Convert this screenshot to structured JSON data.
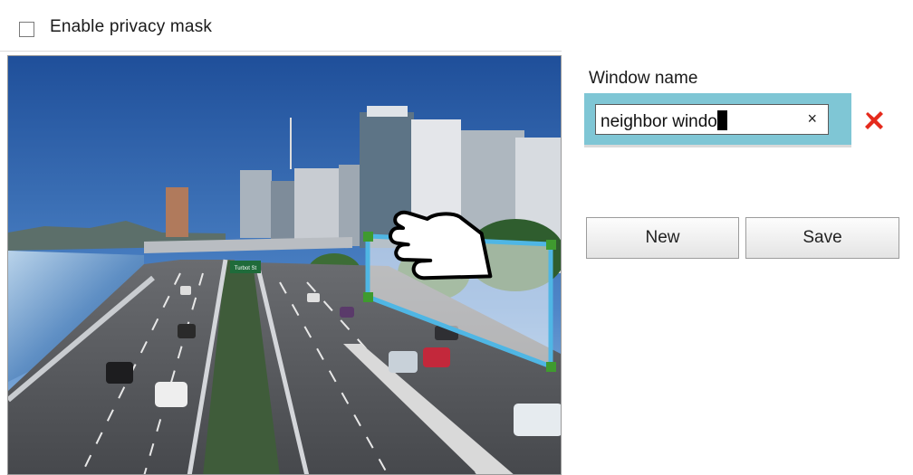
{
  "privacy_mask": {
    "checkbox_label": "Enable privacy mask",
    "checked": false
  },
  "window": {
    "label": "Window name",
    "input_value": "neighbor windo",
    "clear_symbol": "×",
    "delete_icon": "red-x-icon",
    "delete_color": "#e52a1c"
  },
  "buttons": {
    "new_label": "New",
    "save_label": "Save"
  },
  "colors": {
    "mask_outline": "#4fb6e4",
    "mask_handles": "#3f9a2f",
    "name_box_bg": "#7fc6d5"
  },
  "camera": {
    "sign_text": "Turbot St"
  }
}
